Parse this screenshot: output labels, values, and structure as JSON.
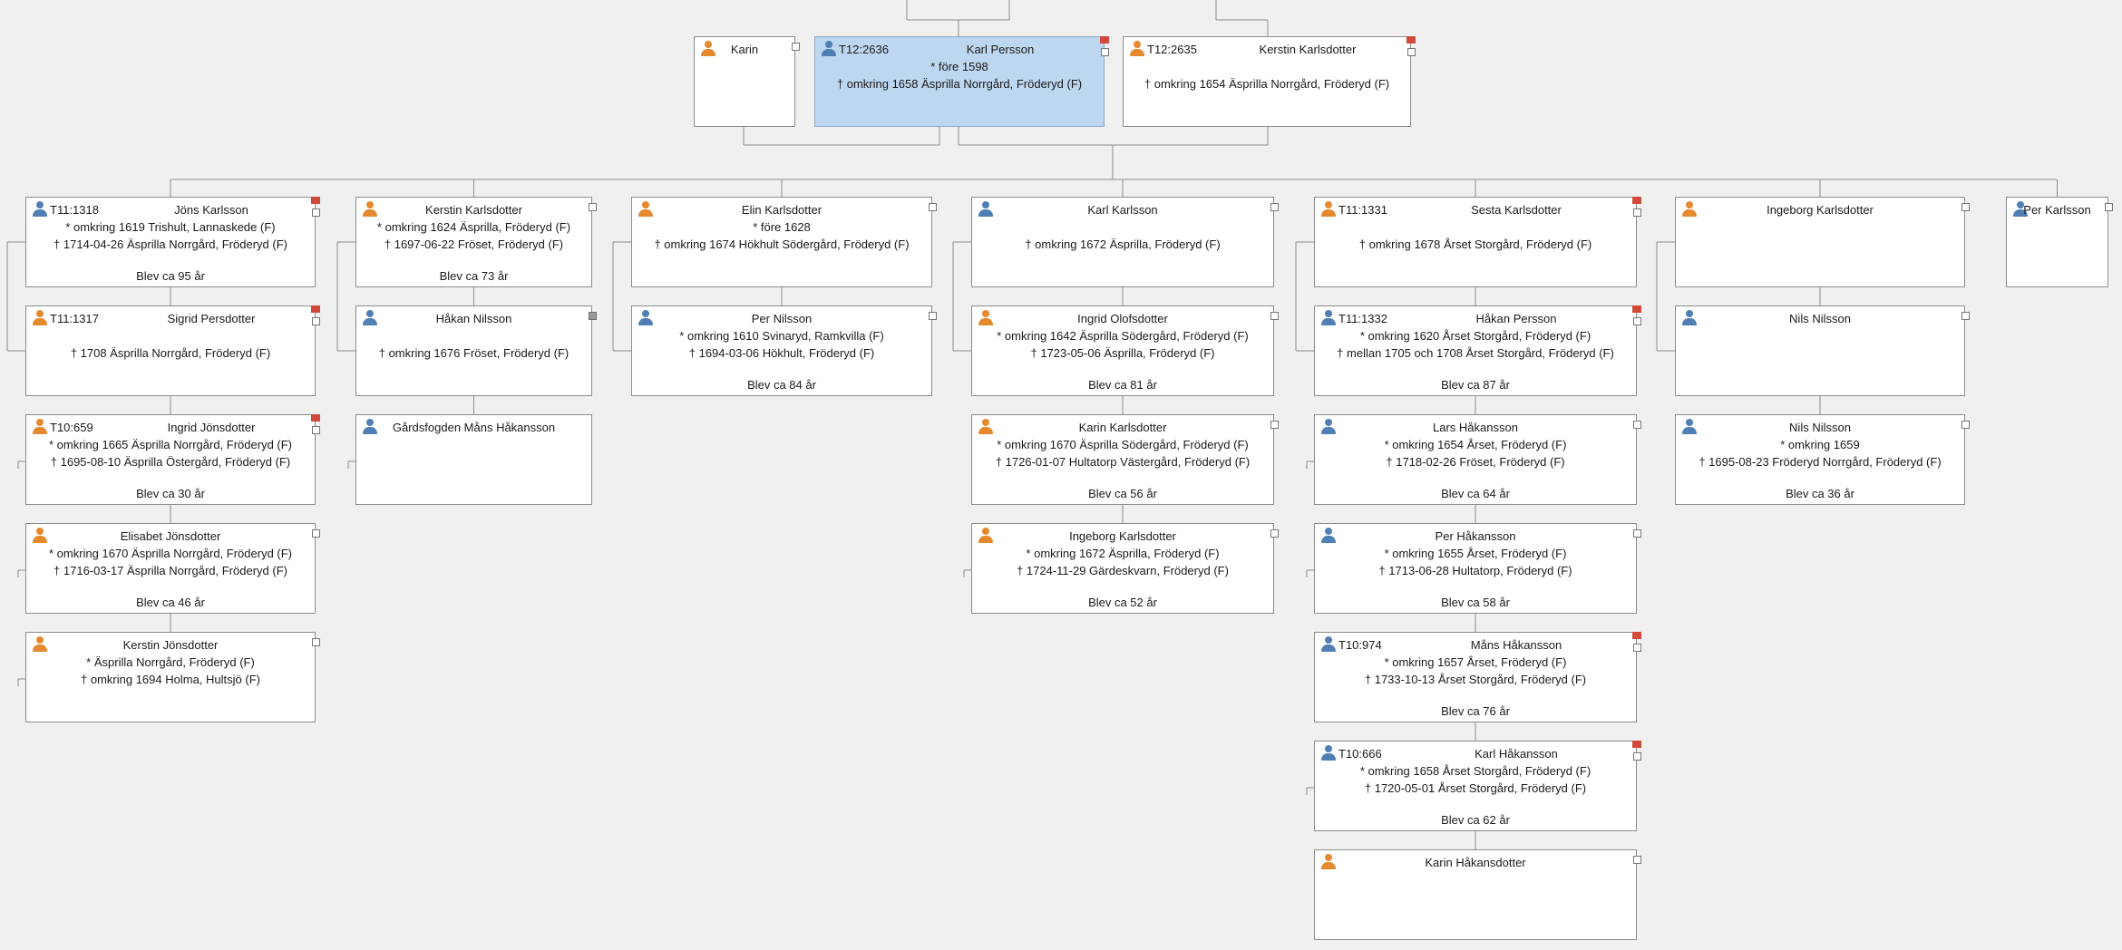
{
  "top": [
    {
      "name": "Karin",
      "gender": "f",
      "code": "",
      "lines": [
        "",
        ""
      ],
      "age": "",
      "selected": false,
      "flag": false,
      "box": "white"
    },
    {
      "name": "Karl Persson",
      "gender": "m",
      "code": "T12:2636",
      "lines": [
        "* före 1598",
        "† omkring 1658 Äsprilla Norrgård, Fröderyd (F)"
      ],
      "age": "",
      "selected": true,
      "flag": true,
      "box": "white"
    },
    {
      "name": "Kerstin Karlsdotter",
      "gender": "f",
      "code": "T12:2635",
      "lines": [
        "",
        "† omkring 1654 Äsprilla Norrgård, Fröderyd (F)"
      ],
      "age": "",
      "selected": false,
      "flag": true,
      "box": "white"
    }
  ],
  "columns": [
    [
      {
        "name": "Jöns Karlsson",
        "gender": "m",
        "code": "T11:1318",
        "lines": [
          "* omkring 1619 Trishult, Lannaskede (F)",
          "† 1714-04-26 Äsprilla Norrgård, Fröderyd (F)"
        ],
        "age": "Blev ca 95 år",
        "flag": true,
        "box": "white"
      },
      {
        "name": "Sigrid Persdotter",
        "gender": "f",
        "code": "T11:1317",
        "lines": [
          "",
          "† 1708 Äsprilla Norrgård, Fröderyd (F)"
        ],
        "age": "",
        "flag": true,
        "box": "white"
      },
      {
        "name": "Ingrid Jönsdotter",
        "gender": "f",
        "code": "T10:659",
        "lines": [
          "* omkring 1665 Äsprilla Norrgård, Fröderyd (F)",
          "† 1695-08-10 Äsprilla Östergård, Fröderyd (F)"
        ],
        "age": "Blev ca 30 år",
        "flag": true,
        "box": "white"
      },
      {
        "name": "Elisabet Jönsdotter",
        "gender": "f",
        "code": "",
        "lines": [
          "* omkring 1670 Äsprilla Norrgård, Fröderyd (F)",
          "† 1716-03-17 Äsprilla Norrgård, Fröderyd (F)"
        ],
        "age": "Blev ca 46 år",
        "flag": false,
        "box": "white"
      },
      {
        "name": "Kerstin Jönsdotter",
        "gender": "f",
        "code": "",
        "lines": [
          "* Äsprilla Norrgård, Fröderyd (F)",
          "† omkring 1694 Holma, Hultsjö (F)"
        ],
        "age": "",
        "flag": false,
        "box": "white"
      }
    ],
    [
      {
        "name": "Kerstin Karlsdotter",
        "gender": "f",
        "code": "",
        "lines": [
          "* omkring 1624 Äsprilla, Fröderyd (F)",
          "† 1697-06-22 Fröset, Fröderyd (F)"
        ],
        "age": "Blev ca 73 år",
        "flag": false,
        "box": "white"
      },
      {
        "name": "Håkan Nilsson",
        "gender": "m",
        "code": "",
        "lines": [
          "",
          "† omkring 1676 Fröset, Fröderyd (F)"
        ],
        "age": "",
        "flag": false,
        "box": "gray"
      },
      {
        "name": "Gårdsfogden Måns Håkansson",
        "gender": "m",
        "code": "",
        "lines": [
          "",
          ""
        ],
        "age": "",
        "flag": false,
        "box": "none"
      }
    ],
    [
      {
        "name": "Elin Karlsdotter",
        "gender": "f",
        "code": "",
        "lines": [
          "* före 1628",
          "† omkring 1674 Hökhult Södergård, Fröderyd (F)"
        ],
        "age": "",
        "flag": false,
        "box": "white"
      },
      {
        "name": "Per Nilsson",
        "gender": "m",
        "code": "",
        "lines": [
          "* omkring 1610 Svinaryd, Ramkvilla (F)",
          "† 1694-03-06 Hökhult, Fröderyd (F)"
        ],
        "age": "Blev ca 84 år",
        "flag": false,
        "box": "white"
      }
    ],
    [
      {
        "name": "Karl Karlsson",
        "gender": "m",
        "code": "",
        "lines": [
          "",
          "† omkring 1672 Äsprilla, Fröderyd (F)"
        ],
        "age": "",
        "flag": false,
        "box": "white"
      },
      {
        "name": "Ingrid Olofsdotter",
        "gender": "f",
        "code": "",
        "lines": [
          "* omkring 1642 Äsprilla Södergård, Fröderyd (F)",
          "† 1723-05-06 Äsprilla, Fröderyd (F)"
        ],
        "age": "Blev ca 81 år",
        "flag": false,
        "box": "white"
      },
      {
        "name": "Karin Karlsdotter",
        "gender": "f",
        "code": "",
        "lines": [
          "* omkring 1670 Äsprilla Södergård, Fröderyd (F)",
          "† 1726-01-07 Hultatorp Västergård, Fröderyd (F)"
        ],
        "age": "Blev ca 56 år",
        "flag": false,
        "box": "white"
      },
      {
        "name": "Ingeborg Karlsdotter",
        "gender": "f",
        "code": "",
        "lines": [
          "* omkring 1672 Äsprilla, Fröderyd (F)",
          "† 1724-11-29 Gärdeskvarn, Fröderyd (F)"
        ],
        "age": "Blev ca 52 år",
        "flag": false,
        "box": "white"
      }
    ],
    [
      {
        "name": "Sesta Karlsdotter",
        "gender": "f",
        "code": "T11:1331",
        "lines": [
          "",
          "† omkring 1678 Årset Storgård, Fröderyd (F)"
        ],
        "age": "",
        "flag": true,
        "box": "white"
      },
      {
        "name": "Håkan Persson",
        "gender": "m",
        "code": "T11:1332",
        "lines": [
          "* omkring 1620 Årset Storgård, Fröderyd (F)",
          "† mellan 1705 och 1708 Årset Storgård, Fröderyd (F)"
        ],
        "age": "Blev ca 87 år",
        "flag": true,
        "box": "white"
      },
      {
        "name": "Lars Håkansson",
        "gender": "m",
        "code": "",
        "lines": [
          "* omkring 1654 Årset, Fröderyd (F)",
          "† 1718-02-26 Fröset, Fröderyd (F)"
        ],
        "age": "Blev ca 64 år",
        "flag": false,
        "box": "white"
      },
      {
        "name": "Per Håkansson",
        "gender": "m",
        "code": "",
        "lines": [
          "* omkring 1655 Årset, Fröderyd (F)",
          "† 1713-06-28 Hultatorp, Fröderyd (F)"
        ],
        "age": "Blev ca 58 år",
        "flag": false,
        "box": "white"
      },
      {
        "name": "Måns Håkansson",
        "gender": "m",
        "code": "T10:974",
        "lines": [
          "* omkring 1657 Årset, Fröderyd (F)",
          "† 1733-10-13 Årset Storgård, Fröderyd (F)"
        ],
        "age": "Blev ca 76 år",
        "flag": true,
        "box": "white"
      },
      {
        "name": "Karl Håkansson",
        "gender": "m",
        "code": "T10:666",
        "lines": [
          "* omkring 1658 Årset Storgård, Fröderyd (F)",
          "† 1720-05-01 Årset Storgård, Fröderyd (F)"
        ],
        "age": "Blev ca 62 år",
        "flag": true,
        "box": "white"
      },
      {
        "name": "Karin Håkansdotter",
        "gender": "f",
        "code": "",
        "lines": [
          "",
          ""
        ],
        "age": "",
        "flag": false,
        "box": "white"
      }
    ],
    [
      {
        "name": "Ingeborg Karlsdotter",
        "gender": "f",
        "code": "",
        "lines": [
          "",
          ""
        ],
        "age": "",
        "flag": false,
        "box": "white"
      },
      {
        "name": "Nils Nilsson",
        "gender": "m",
        "code": "",
        "lines": [
          "",
          ""
        ],
        "age": "",
        "flag": false,
        "box": "white"
      },
      {
        "name": "Nils Nilsson",
        "gender": "m",
        "code": "",
        "lines": [
          "* omkring 1659",
          "† 1695-08-23 Fröderyd Norrgård, Fröderyd (F)"
        ],
        "age": "Blev ca 36 år",
        "flag": false,
        "box": "white"
      }
    ],
    [
      {
        "name": "Per Karlsson",
        "gender": "m",
        "code": "",
        "lines": [
          "",
          ""
        ],
        "age": "",
        "flag": false,
        "box": "white"
      }
    ]
  ],
  "colors": {
    "background": "#f0f0f0",
    "selected": "#bcd7ef",
    "male": "#4f7fb5",
    "female": "#e5892f",
    "flag": "#d0493a",
    "connector": "#8c8c8c"
  }
}
